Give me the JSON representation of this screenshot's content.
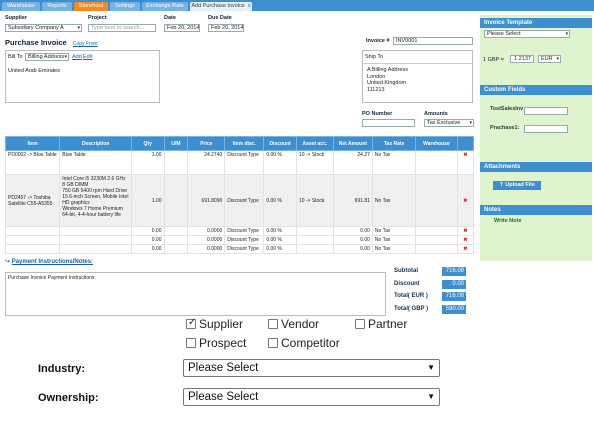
{
  "tabs": [
    "Warehouse",
    "Reports",
    "Storefront",
    "Settings",
    "Exchange Rate",
    "Add Purchase Invoice"
  ],
  "tab_close": "x",
  "header": {
    "supplier_label": "Supplier",
    "supplier_value": "Subsidiary Company A",
    "project_label": "Project",
    "project_placeholder": "Type here to search...",
    "date_label": "Date",
    "date_value": "Feb 20, 2014",
    "due_date_label": "Due Date",
    "due_date_value": "Feb 20, 2014"
  },
  "title": "Purchase Invoice",
  "copy_from": "Copy From",
  "invoice_no_label": "Invoice #",
  "invoice_no_value": "INV0001",
  "bill_to": {
    "label": "Bill To",
    "select": "Billing Address",
    "add": "Add",
    "edit": "Edit",
    "text": "United Arab Emirates"
  },
  "ship_to": {
    "label": "Ship To",
    "lines": [
      "A Billing Address",
      "London",
      "United Kingdom",
      "111213"
    ]
  },
  "po_number_label": "PO Number",
  "amounts_label": "Amounts",
  "amounts_value": "Tax Exclusive",
  "grid": {
    "headers": [
      "Item",
      "Description",
      "Qty",
      "U/M",
      "Price",
      "Item disc.",
      "Discount",
      "Asset acc.",
      "Net Amount",
      "Tax Rate",
      "Warehouse",
      ""
    ],
    "rows": [
      {
        "item": "PD0002 -> Blue Table",
        "description": "Blue Table",
        "qty": "1.00",
        "um": "",
        "price": "24.2740",
        "item_disc": "Discount Type",
        "discount": "0.00 %",
        "asset": "10 -> Stock",
        "net": "24.27",
        "tax": "No Tax",
        "warehouse": "",
        "del": "✖"
      },
      {
        "item": "PD2457 -> Toshiba Satellite C55-A5355",
        "description": "Intel Core i5 3230M 2.6 GHz\n8 GB DIMM\n750 GB 5400 rpm Hard Drive\n15.6-inch Screen, Mobile Intel HD graphics\nWindows 7 Home Premium 64-bit, 4-4-hour battery life",
        "qty": "1.00",
        "um": "",
        "price": "691.8090",
        "item_disc": "Discount Type",
        "discount": "0.00 %",
        "asset": "10 -> Stock",
        "net": "691.81",
        "tax": "No Tax",
        "warehouse": "",
        "del": "✖"
      },
      {
        "item": "",
        "description": "",
        "qty": "0.00",
        "um": "",
        "price": "0.0000",
        "item_disc": "Discount Type",
        "discount": "0.00 %",
        "asset": "",
        "net": "0.00",
        "tax": "No Tax",
        "warehouse": "",
        "del": "✖"
      },
      {
        "item": "",
        "description": "",
        "qty": "0.00",
        "um": "",
        "price": "0.0000",
        "item_disc": "Discount Type",
        "discount": "0.00 %",
        "asset": "",
        "net": "0.00",
        "tax": "No Tax",
        "warehouse": "",
        "del": "✖"
      },
      {
        "item": "",
        "description": "",
        "qty": "0.00",
        "um": "",
        "price": "0.0000",
        "item_disc": "Discount Type",
        "discount": "0.00 %",
        "asset": "",
        "net": "0.00",
        "tax": "No Tax",
        "warehouse": "",
        "del": "✖"
      }
    ]
  },
  "payment": {
    "link": "Payment Instructions/Notes:",
    "text": "Purchase Invoice Payment Instructions:"
  },
  "totals": [
    {
      "label": "Subtotal",
      "value": "716.08"
    },
    {
      "label": "Discount",
      "value": "0.00"
    },
    {
      "label": "Total( EUR )",
      "value": "716.08"
    },
    {
      "label": "Total( GBP )",
      "value": "590.00"
    }
  ],
  "sidebar": {
    "template_title": "Invoice Template",
    "template_select": "Please Select",
    "rate_left": "1 GBP =",
    "rate_value": "1.2137",
    "rate_currency": "EUR",
    "custom_title": "Custom Fields",
    "custom_field_1": "TestSalesInv",
    "custom_field_2": "Prachase1:",
    "attachments_title": "Attachments",
    "upload_label": "Upload File",
    "notes_title": "Notes",
    "write_note": "Write Note"
  },
  "roles": {
    "items": [
      {
        "label": "Supplier",
        "checked": true
      },
      {
        "label": "Vendor",
        "checked": false
      },
      {
        "label": "Partner",
        "checked": false
      },
      {
        "label": "Prospect",
        "checked": false
      },
      {
        "label": "Competitor",
        "checked": false
      }
    ]
  },
  "industry": {
    "label": "Industry:",
    "value": "Please Select"
  },
  "ownership": {
    "label": "Ownership:",
    "value": "Please Select"
  },
  "colors": {
    "tab_bar": "#3d8fd0",
    "active_tab": "#f6891f",
    "sidebar_bg": "#dff3cf",
    "delete": "#e0202a"
  }
}
